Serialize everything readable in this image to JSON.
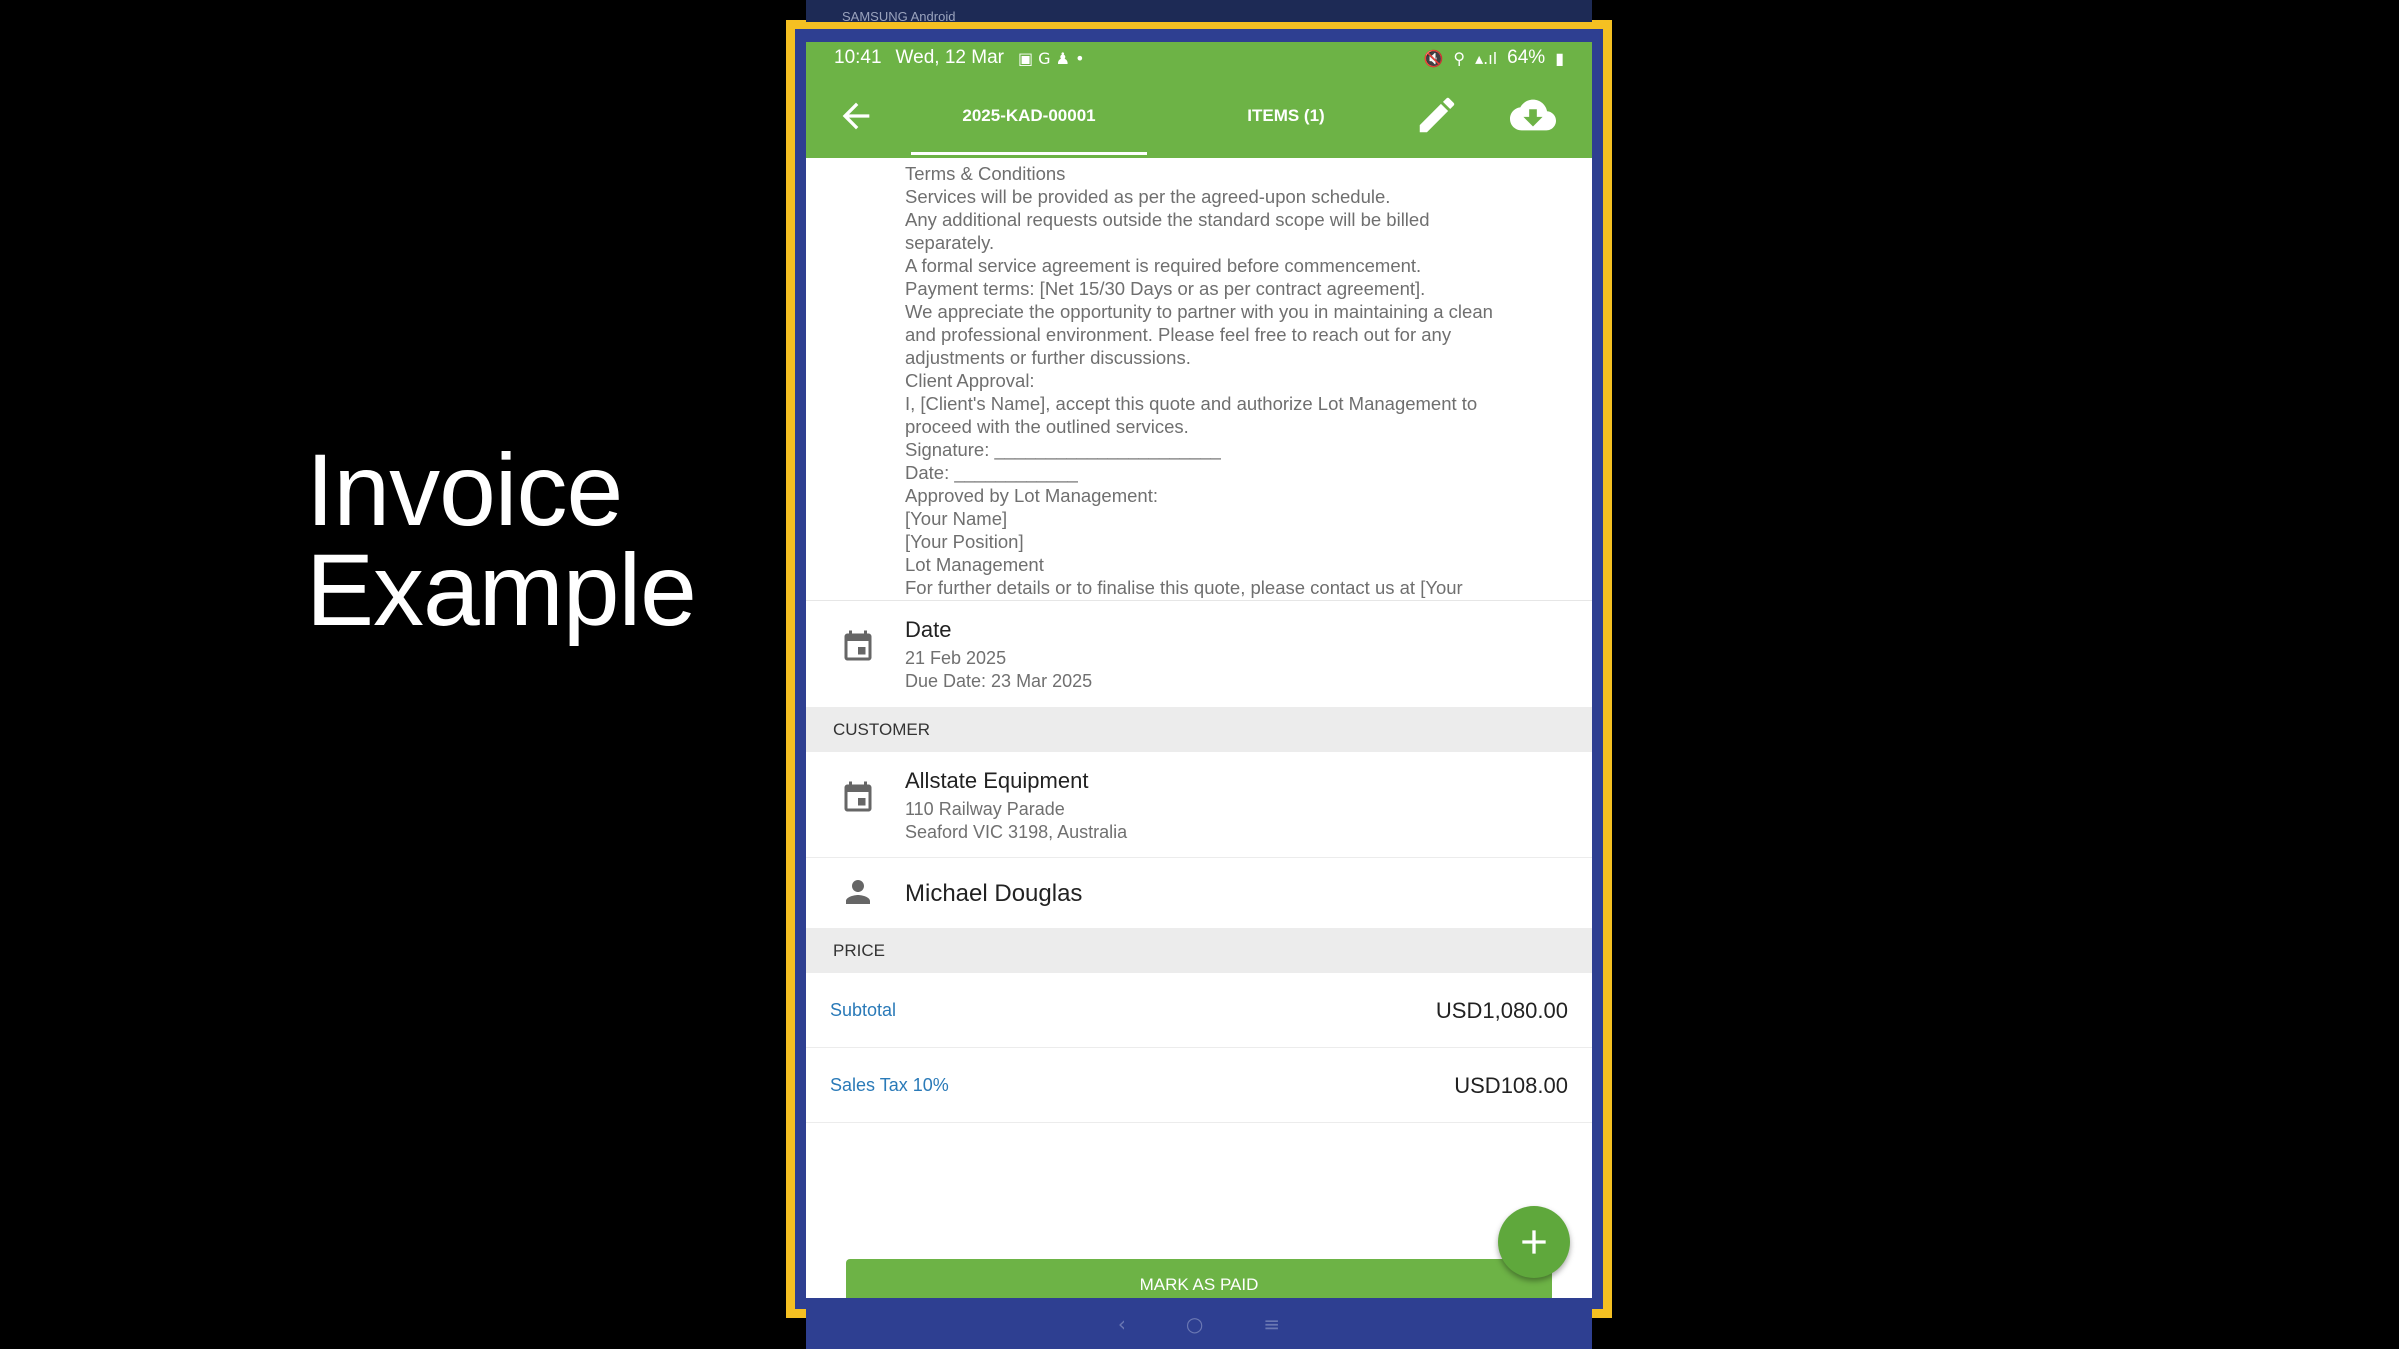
{
  "slide": {
    "title_line1": "Invoice",
    "title_line2": "Example"
  },
  "device": {
    "top_label": "SAMSUNG  Android"
  },
  "status_bar": {
    "time": "10:41",
    "date": "Wed, 12 Mar",
    "battery": "64%"
  },
  "app_bar": {
    "tab_invoice": "2025-KAD-00001",
    "tab_items": "ITEMS (1)"
  },
  "terms": {
    "lines": [
      "Terms & Conditions",
      "Services will be provided as per the agreed-upon schedule.",
      "Any additional requests outside the standard scope will be billed",
      "separately.",
      "A formal service agreement is required before commencement.",
      "Payment terms: [Net 15/30 Days or as per contract agreement].",
      "We appreciate the opportunity to partner with you in maintaining a clean",
      "and professional environment. Please feel free to reach out for any",
      "adjustments or further discussions.",
      "Client Approval:",
      "I, [Client's Name], accept this quote and authorize Lot Management to",
      "proceed with the outlined services.",
      "Signature: ______________________",
      "Date: ____________",
      "Approved by Lot Management:",
      "[Your Name]",
      "[Your Position]",
      "Lot Management",
      "For further details or to finalise this quote, please contact us at [Your"
    ]
  },
  "date_row": {
    "title": "Date",
    "date": "21 Feb 2025",
    "due": "Due Date: 23 Mar 2025"
  },
  "customer": {
    "header": "CUSTOMER",
    "name": "Allstate Equipment",
    "address1": "110 Railway Parade",
    "address2": "Seaford VIC 3198, Australia",
    "contact": "Michael Douglas"
  },
  "price": {
    "header": "PRICE",
    "subtotal_label": "Subtotal",
    "subtotal_value": "USD1,080.00",
    "tax_label": "Sales Tax 10%",
    "tax_value": "USD108.00"
  },
  "actions": {
    "mark_paid": "MARK AS PAID"
  },
  "colors": {
    "brand_green": "#6db346",
    "link_blue": "#2a7ab8",
    "frame_yellow": "#f5c022",
    "device_blue": "#2e3f91"
  }
}
